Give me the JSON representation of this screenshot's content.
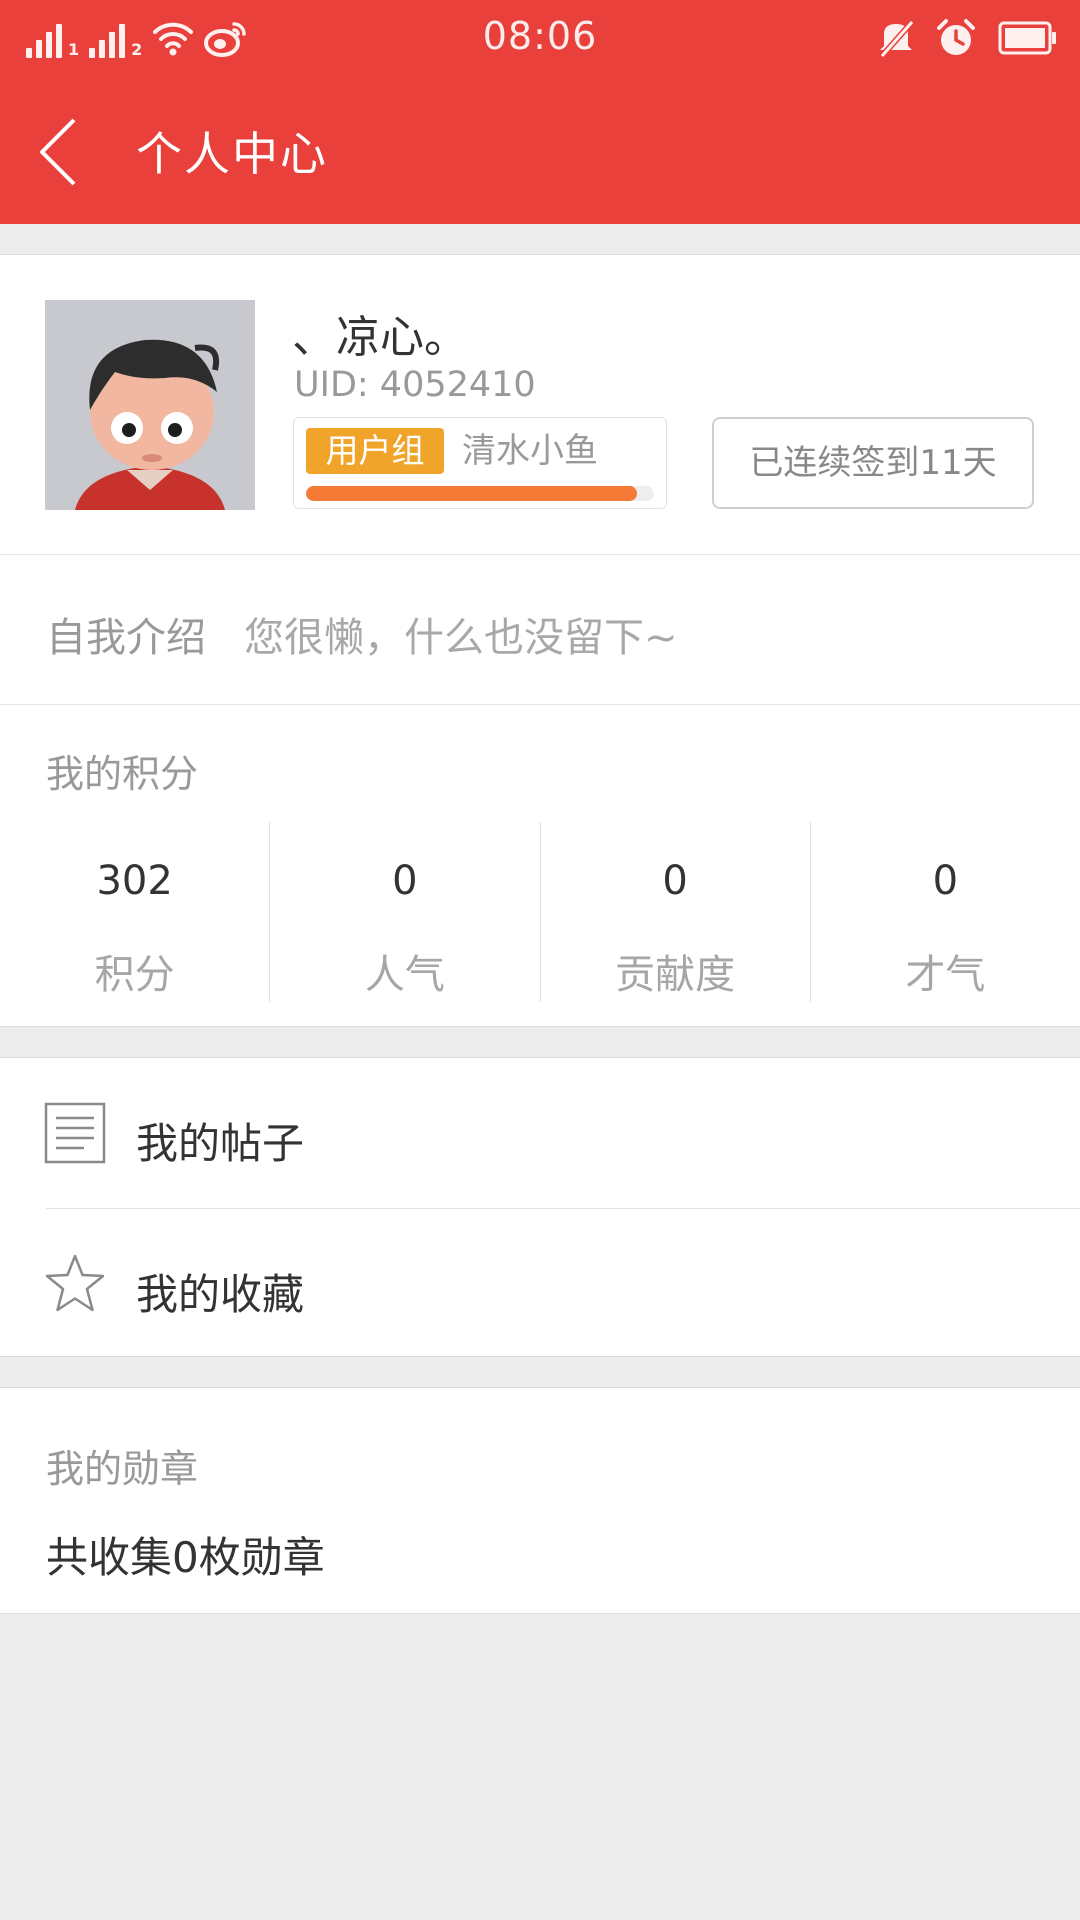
{
  "status_bar": {
    "time": "08:06",
    "sim1": "1",
    "sim2": "2"
  },
  "header": {
    "title": "个人中心",
    "back_icon": "chevron-left-icon"
  },
  "profile": {
    "username": "、凉心。",
    "uid": "UID: 4052410",
    "group_tag": "用户组",
    "group_name": "清水小鱼",
    "level_progress": 0.95,
    "checkin_label": "已连续签到11天"
  },
  "intro": {
    "label": "自我介绍",
    "text": "您很懒，什么也没留下~"
  },
  "points": {
    "title": "我的积分",
    "stats": [
      {
        "value": "302",
        "label": "积分"
      },
      {
        "value": "0",
        "label": "人气"
      },
      {
        "value": "0",
        "label": "贡献度"
      },
      {
        "value": "0",
        "label": "才气"
      }
    ]
  },
  "menu": {
    "items": [
      {
        "label": "我的帖子",
        "icon": "document-icon"
      },
      {
        "label": "我的收藏",
        "icon": "star-icon"
      }
    ]
  },
  "medals": {
    "title": "我的勋章",
    "count_text": "共收集0枚勋章"
  },
  "colors": {
    "brand_red": "#e9403c",
    "group_tag": "#f0a52a",
    "progress": "#f47a35"
  }
}
